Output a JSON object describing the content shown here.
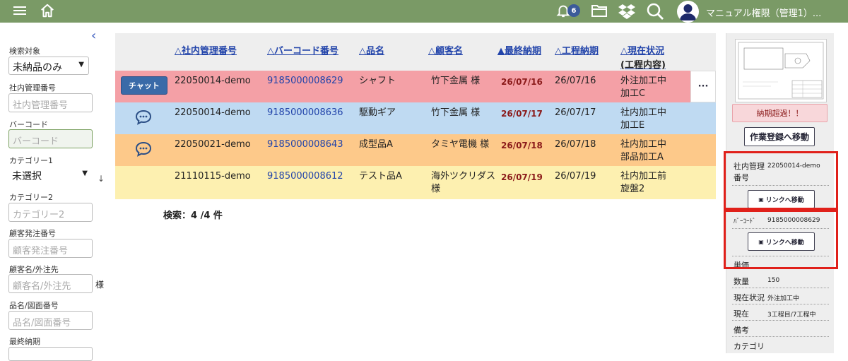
{
  "topbar": {
    "notification_count": "6",
    "user_name": "マニュアル権限（管理1）..."
  },
  "sidebar": {
    "search_target_label": "検索対象",
    "search_target_value": "未納品のみ",
    "internal_no_label": "社内管理番号",
    "internal_no_placeholder": "社内管理番号",
    "barcode_label": "バーコード",
    "barcode_placeholder": "バーコード",
    "category1_label": "カテゴリー1",
    "category1_value": "未選択",
    "category2_label": "カテゴリー2",
    "category2_placeholder": "カテゴリー2",
    "customer_order_label": "顧客発注番号",
    "customer_order_placeholder": "顧客発注番号",
    "customer_name_label": "顧客名/外注先",
    "customer_name_placeholder": "顧客名/外注先",
    "customer_suffix": "様",
    "product_label": "品名/図面番号",
    "product_placeholder": "品名/図面番号",
    "final_due_label": "最終納期"
  },
  "table": {
    "headers": {
      "internal_no": "△社内管理番号",
      "barcode": "△バーコード番号",
      "product": "△品名",
      "customer": "△顧客名",
      "final_due": "▲最終納期",
      "process_due": "△工程納期",
      "status": "△現在状況",
      "status_sub": "(工程内容)"
    },
    "chat_label": "チャット",
    "more_label": "···",
    "rows": [
      {
        "internal_no": "22050014-demo",
        "barcode": "9185000008629",
        "product": "シャフト",
        "customer": "竹下金属 様",
        "final_due": "26/07/16",
        "process_due": "26/07/16",
        "status1": "外注加工中",
        "status2": "加工C",
        "bg": "#f4a0a6"
      },
      {
        "internal_no": "22050014-demo",
        "barcode": "9185000008636",
        "product": "駆動ギア",
        "customer": "竹下金属 様",
        "final_due": "26/07/17",
        "process_due": "26/07/17",
        "status1": "社内加工中",
        "status2": "加工E",
        "bg": "#bfdaf2"
      },
      {
        "internal_no": "22050021-demo",
        "barcode": "9185000008643",
        "product": "成型品A",
        "customer": "タミヤ電機 様",
        "final_due": "26/07/18",
        "process_due": "26/07/18",
        "status1": "社内加工中",
        "status2": "部品加工A",
        "bg": "#fdc98a"
      },
      {
        "internal_no": "21110115-demo",
        "barcode": "9185000008612",
        "product": "テスト品A",
        "customer": "海外ツクリダス",
        "customer2": "様",
        "final_due": "26/07/19",
        "process_due": "26/07/19",
        "status1": "社内加工前",
        "status2": "旋盤2",
        "bg": "#fdf0b0"
      }
    ],
    "count_text": "検索：4 /4 件"
  },
  "detail": {
    "overdue_text": "納期超過！！",
    "register_button": "作業登録へ移動",
    "internal_no_label1": "社内管理",
    "internal_no_label2": "番号",
    "internal_no_value": "22050014-demo",
    "link_button": "リンクへ移動",
    "barcode_label": "ﾊﾞｰｺｰﾄﾞ",
    "barcode_value": "9185000008629",
    "link_button2": "リンクへ移動",
    "unit_price_label": "単価",
    "quantity_label": "数量",
    "quantity_value": "150",
    "status_label": "現在状況",
    "status_value": "外注加工中",
    "current_label": "現在",
    "current_value": "3工程目/7工程中",
    "note_label": "備考",
    "category_label": "カテゴリ"
  }
}
